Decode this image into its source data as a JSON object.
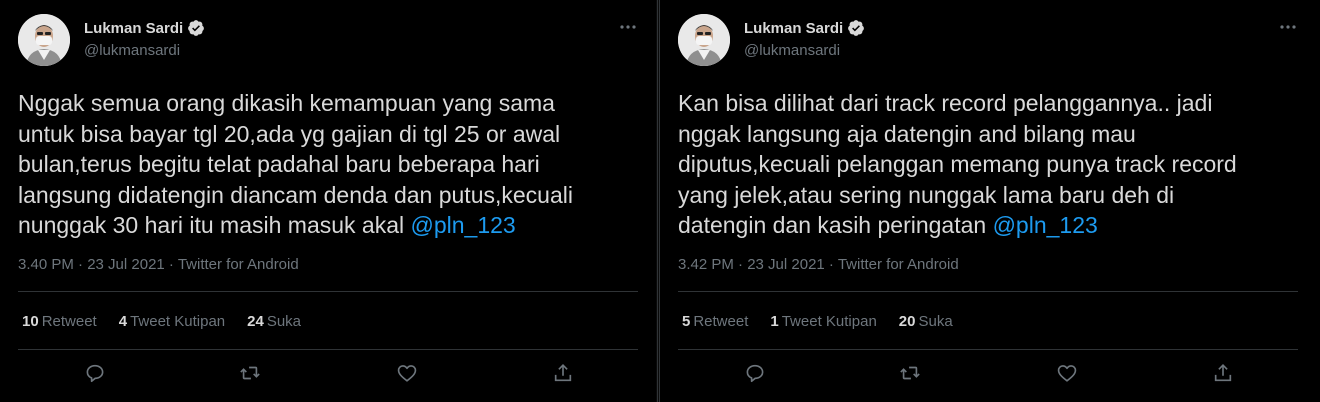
{
  "tweets": [
    {
      "author_name": "Lukman Sardi",
      "handle": "@lukmansardi",
      "text": "Nggak semua orang dikasih kemampuan yang sama\nuntuk bisa bayar tgl 20,ada yg gajian di tgl 25 or awal\nbulan,terus begitu telat padahal baru beberapa hari\nlangsung didatengin diancam denda dan putus,kecuali\nnunggak 30 hari itu masih masuk akal",
      "mention": "@pln_123",
      "meta": "3.40 PM · 23 Jul 2021 · Twitter for Android",
      "retweets_count": "10",
      "retweets_label": "Retweet",
      "quotes_count": "4",
      "quotes_label": "Tweet Kutipan",
      "likes_count": "24",
      "likes_label": "Suka"
    },
    {
      "author_name": "Lukman Sardi",
      "handle": "@lukmansardi",
      "text": "Kan bisa dilihat dari track record pelanggannya.. jadi\nnggak langsung aja datengin and bilang mau\ndiputus,kecuali pelanggan memang punya track record\nyang jelek,atau sering nunggak lama baru deh di\ndatengin dan kasih peringatan",
      "mention": "@pln_123",
      "meta": "3.42 PM · 23 Jul 2021 · Twitter for Android",
      "retweets_count": "5",
      "retweets_label": "Retweet",
      "quotes_count": "1",
      "quotes_label": "Tweet Kutipan",
      "likes_count": "20",
      "likes_label": "Suka"
    }
  ],
  "colors": {
    "background": "#000000",
    "text": "#d9d9d9",
    "secondary": "#6e767d",
    "link": "#1d9bf0",
    "verified": "#d9d9d9"
  },
  "icons": [
    "verified-badge-icon",
    "more-icon",
    "reply-icon",
    "retweet-icon",
    "like-icon",
    "share-icon"
  ]
}
